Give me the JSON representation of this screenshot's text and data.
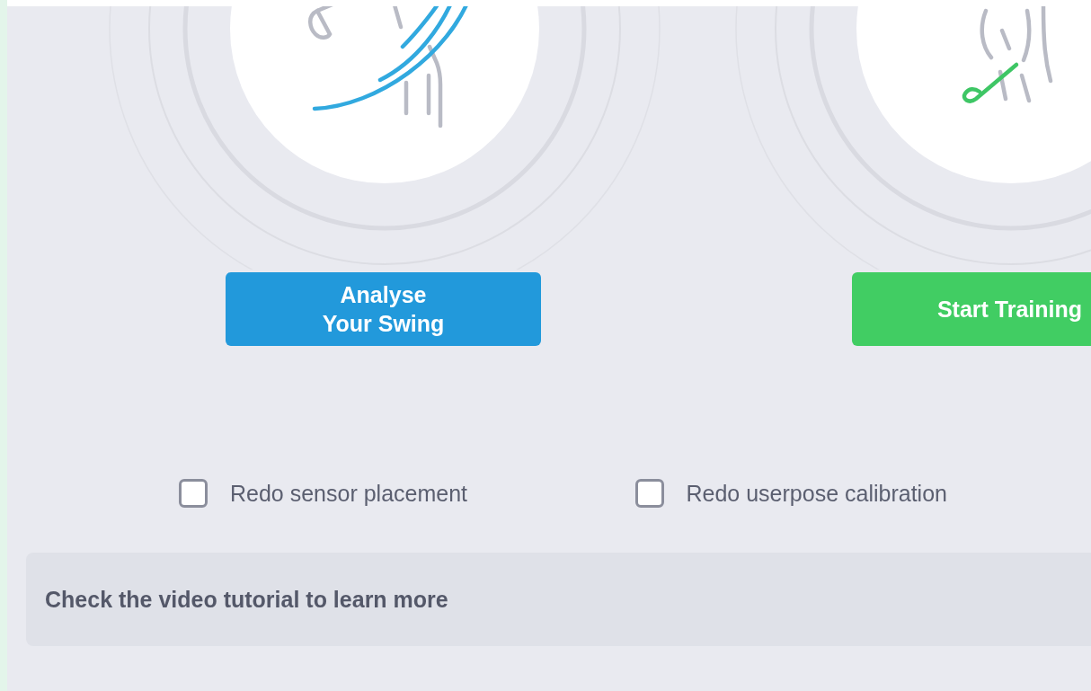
{
  "actions": [
    {
      "kind": "analyse",
      "label": "Analyse Your Swing"
    },
    {
      "kind": "training",
      "label": "Start Training"
    }
  ],
  "options": [
    {
      "label": "Redo sensor placement",
      "checked": false
    },
    {
      "label": "Redo userpose calibration",
      "checked": false
    }
  ],
  "tutorial_banner": {
    "text": "Check the video tutorial to learn more"
  }
}
